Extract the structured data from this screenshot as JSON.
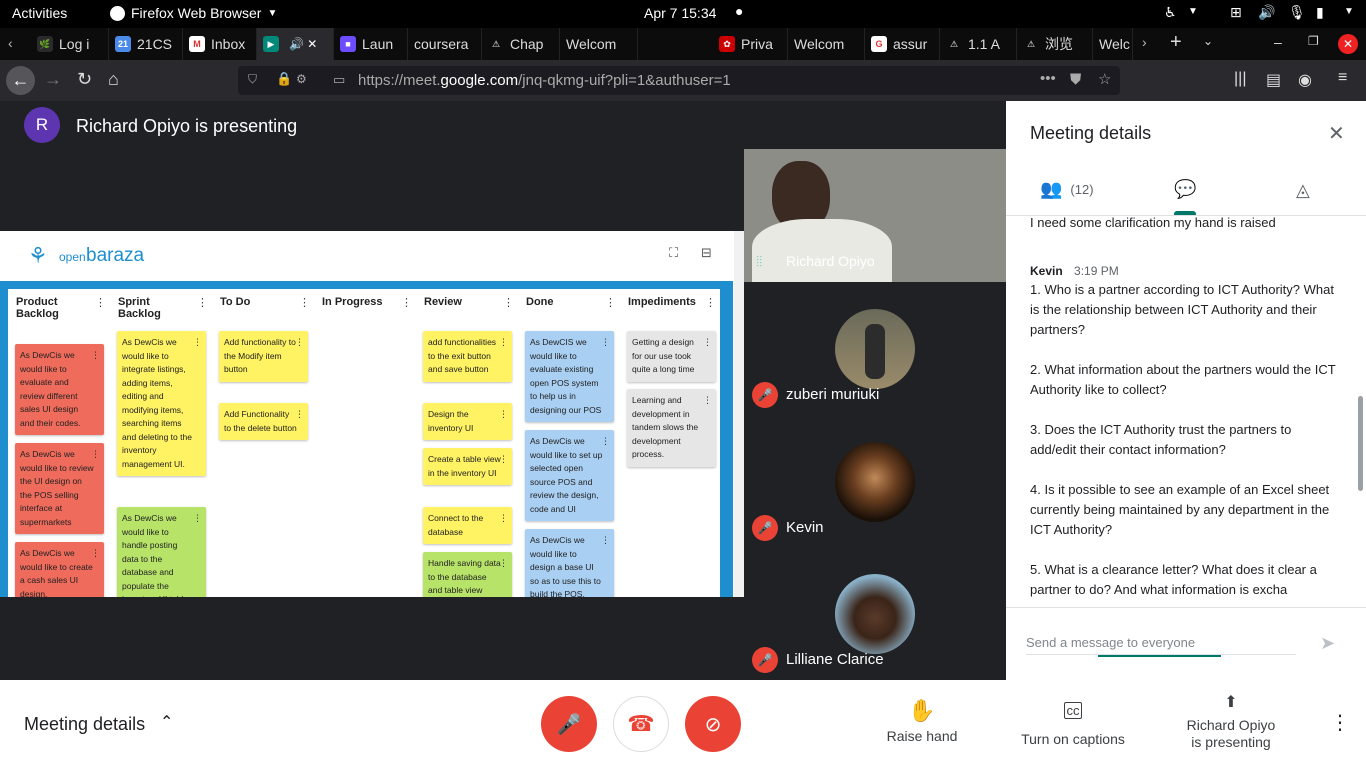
{
  "system": {
    "activities": "Activities",
    "app": "Firefox Web Browser",
    "clock": "Apr 7  15:34"
  },
  "tabs": [
    {
      "label": "Log i",
      "fav": "#2a2a2e",
      "glyph": "🌿"
    },
    {
      "label": "21CS",
      "fav": "#4a8ae8",
      "glyph": "21"
    },
    {
      "label": "Inbox",
      "fav": "#fff",
      "glyph": "M"
    },
    {
      "label": "",
      "fav": "#00897b",
      "glyph": "▶"
    },
    {
      "label": "Laun",
      "fav": "#6e4cff",
      "glyph": "■"
    },
    {
      "label": "coursera",
      "fav": "",
      "glyph": ""
    },
    {
      "label": "Chap",
      "fav": "",
      "glyph": "⚠"
    },
    {
      "label": "Welcom",
      "fav": "",
      "glyph": ""
    },
    {
      "label": "Priva",
      "fav": "#c00",
      "glyph": "✿"
    },
    {
      "label": "Welcom",
      "fav": "",
      "glyph": ""
    },
    {
      "label": "assur",
      "fav": "#fff",
      "glyph": "G"
    },
    {
      "label": "1.1 A",
      "fav": "",
      "glyph": "⚠"
    },
    {
      "label": "浏览",
      "fav": "",
      "glyph": "⚠"
    },
    {
      "label": "Welc",
      "fav": "",
      "glyph": ""
    }
  ],
  "url": {
    "prefix": "https://meet.",
    "domain": "google.com",
    "rest": "/jnq-qkmg-uif?pli=1&authuser=1"
  },
  "presenter": {
    "avatar_letter": "R",
    "text": "Richard Opiyo is presenting"
  },
  "board": {
    "logo_small": "open",
    "logo_big": "baraza",
    "columns": [
      {
        "title": "Product Backlog",
        "cards": [
          {
            "text": "As DewCis we would like to evaluate  and review different sales UI design and their codes.",
            "color": "red"
          },
          {
            "text": "As DewCis we would like to review the UI design on the POS selling interface at supermarkets",
            "color": "red"
          },
          {
            "text": "As DewCis we would like to create a cash sales UI design.",
            "color": "red"
          }
        ]
      },
      {
        "title": "Sprint Backlog",
        "cards": [
          {
            "text": "As DewCis we would like to integrate listings, adding items, editing and modifying items, searching items and deleting to the inventory management UI.",
            "color": "yellow"
          },
          {
            "text": "As DewCis we would like to handle posting data to the database and populate the inventory UI table.",
            "color": "green"
          }
        ]
      },
      {
        "title": "To Do",
        "cards": [
          {
            "text": "Add functionality to the Modify item button",
            "color": "yellow"
          },
          {
            "text": "Add Functionality to the delete button",
            "color": "yellow"
          }
        ]
      },
      {
        "title": "In Progress",
        "cards": []
      },
      {
        "title": "Review",
        "cards": [
          {
            "text": "add functionalities to the exit button and save button",
            "color": "yellow"
          },
          {
            "text": "Design the inventory UI",
            "color": "yellow"
          },
          {
            "text": "Create a table view in the inventory UI",
            "color": "yellow"
          },
          {
            "text": "Connect to the database",
            "color": "yellow"
          },
          {
            "text": "Handle saving data to the database and table view",
            "color": "green"
          }
        ]
      },
      {
        "title": "Done",
        "cards": [
          {
            "text": "As DewCIS we would like to evaluate existing open POS system to help us in designing our POS",
            "color": "blue"
          },
          {
            "text": "As DewCis we would like to set up selected open source POS and review the design, code and UI",
            "color": "blue"
          },
          {
            "text": "As DewCis we would like to design a base UI so as to use this to build the POS.",
            "color": "blue"
          }
        ]
      },
      {
        "title": "Impediments",
        "cards": [
          {
            "text": "Getting a design for our use took quite a long time",
            "color": "grey"
          },
          {
            "text": "Learning and development in tandem slows the development process.",
            "color": "grey"
          }
        ]
      }
    ]
  },
  "participants": [
    {
      "name": "Richard Opiyo"
    },
    {
      "name": "zuberi muriuki"
    },
    {
      "name": "Kevin"
    },
    {
      "name": "Lilliane Clarice"
    }
  ],
  "side": {
    "title": "Meeting details",
    "people_count": "(12)",
    "top_msg": "I need some clarification my hand is raised",
    "sender": "Kevin",
    "time": "3:19 PM",
    "messages": [
      "1. Who is a partner according to ICT Authority? What is the relationship between ICT Authority and their partners?",
      "2. What information about the partners would the ICT Authority like to collect?",
      "3. Does the ICT Authority trust the partners to add/edit their contact information?",
      "4. Is it possible to see an example of an Excel sheet currently being maintained by any department in the ICT Authority?",
      "5. What is a clearance letter? What does it clear a partner to do? And what information is excha"
    ],
    "input_placeholder": "Send a message to everyone"
  },
  "bottom": {
    "details": "Meeting details",
    "raise": "Raise hand",
    "captions": "Turn on captions",
    "present_line1": "Richard Opiyo",
    "present_line2": "is presenting"
  }
}
